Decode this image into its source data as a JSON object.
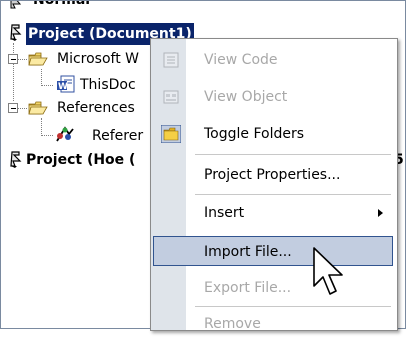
{
  "tree": {
    "partial_top_label": "Normal",
    "project_document": "Project (Document1)",
    "microsoft_word_folder": "Microsoft W",
    "this_document": "ThisDoc",
    "references_folder": "References",
    "reference_item": "Referer",
    "project_hoe": "Project (Hoe (",
    "project_hoe_tail": "5"
  },
  "menu": {
    "items": [
      {
        "label": "View Code",
        "enabled": false,
        "icon": "view-code-icon"
      },
      {
        "label": "View Object",
        "enabled": false,
        "icon": "view-object-icon"
      },
      {
        "label": "Toggle Folders",
        "enabled": true,
        "icon": "folder-icon"
      },
      {
        "label": "Project Properties...",
        "enabled": true
      },
      {
        "label": "Insert",
        "enabled": true,
        "submenu": true
      },
      {
        "label": "Import File...",
        "enabled": true,
        "highlighted": true
      },
      {
        "label": "Export File...",
        "enabled": false
      },
      {
        "label": "Remove",
        "enabled": false
      }
    ]
  },
  "colors": {
    "selection": "#0a246a",
    "menu_highlight": "#c2cde0",
    "menu_highlight_border": "#31548f",
    "gutter": "#dfe4ea",
    "disabled_text": "#a8a8a8"
  }
}
